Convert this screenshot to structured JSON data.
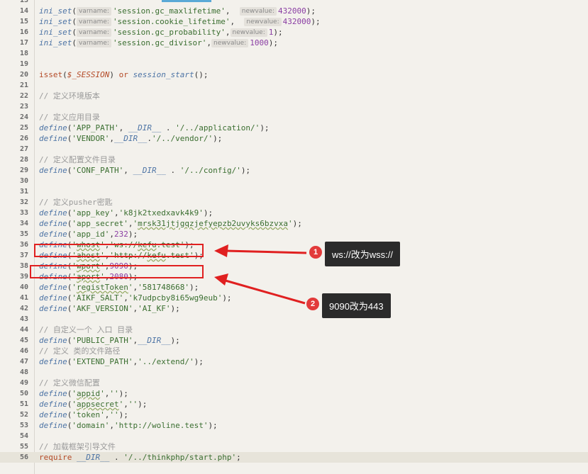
{
  "colors": {
    "annotation_red": "#e02020",
    "callout_bg": "#2b2b2b",
    "badge_red": "#e23a3a"
  },
  "lines": [
    {
      "n": "13",
      "html": ""
    },
    {
      "n": "14",
      "html": "<span class=\"fn\">ini_set</span>(<span class=\"hint\">varname:</span><span class=\"str\">'session.gc_maxlifetime'</span>,  <span class=\"hint\">newvalue:</span><span class=\"num\">432000</span>);"
    },
    {
      "n": "15",
      "html": "<span class=\"fn\">ini_set</span>(<span class=\"hint\">varname:</span><span class=\"str\">'session.cookie_lifetime'</span>,  <span class=\"hint\">newvalue:</span><span class=\"num\">432000</span>);"
    },
    {
      "n": "16",
      "html": "<span class=\"fn\">ini_set</span>(<span class=\"hint\">varname:</span><span class=\"str\">'session.gc_probability'</span>,<span class=\"hint\">newvalue:</span><span class=\"num\">1</span>);"
    },
    {
      "n": "17",
      "html": "<span class=\"fn\">ini_set</span>(<span class=\"hint\">varname:</span><span class=\"str\">'session.gc_divisor'</span>,<span class=\"hint\">newvalue:</span><span class=\"num\">1000</span>);"
    },
    {
      "n": "18",
      "html": ""
    },
    {
      "n": "19",
      "html": ""
    },
    {
      "n": "20",
      "html": "<span class=\"kw\">isset</span>(<span class=\"var\">$_SESSION</span>) <span class=\"kw\">or</span> <span class=\"fn\">session_start</span>();"
    },
    {
      "n": "21",
      "html": ""
    },
    {
      "n": "22",
      "html": "<span class=\"cm\">// 定义环境版本</span>"
    },
    {
      "n": "23",
      "html": ""
    },
    {
      "n": "24",
      "html": "<span class=\"cm\">// 定义应用目录</span>"
    },
    {
      "n": "25",
      "html": "<span class=\"fn\">define</span>(<span class=\"str\">'APP_PATH'</span>, <span class=\"const\">__DIR__</span> . <span class=\"str\">'/../application/'</span>);"
    },
    {
      "n": "26",
      "html": "<span class=\"fn\">define</span>(<span class=\"str\">'VENDOR'</span>,<span class=\"const\">__DIR__</span>.<span class=\"str\">'/../vendor/'</span>);"
    },
    {
      "n": "27",
      "html": ""
    },
    {
      "n": "28",
      "html": "<span class=\"cm\">// 定义配置文件目录</span>"
    },
    {
      "n": "29",
      "html": "<span class=\"fn\">define</span>(<span class=\"str\">'CONF_PATH'</span>, <span class=\"const\">__DIR__</span> . <span class=\"str\">'/../config/'</span>);"
    },
    {
      "n": "30",
      "html": ""
    },
    {
      "n": "31",
      "html": ""
    },
    {
      "n": "32",
      "html": "<span class=\"cm\">// 定义pusher密匙</span>"
    },
    {
      "n": "33",
      "html": "<span class=\"fn\">define</span>(<span class=\"str\">'app_key'</span>,<span class=\"str\">'k8jk2txedxavk4k9'</span>);"
    },
    {
      "n": "34",
      "html": "<span class=\"fn\">define</span>(<span class=\"str\">'app_secret'</span>,<span class=\"str\">'<span class=\"squig\">mrsk31jtjgqzjefyepzb2uvyks6bzvxa</span>'</span>);"
    },
    {
      "n": "35",
      "html": "<span class=\"fn\">define</span>(<span class=\"str\">'app_id'</span>,<span class=\"num\">232</span>);"
    },
    {
      "n": "36",
      "html": "<span class=\"fn\">define</span>(<span class=\"str\">'<span class=\"squig\">whost</span>'</span>,<span class=\"str\">'ws://<span class=\"squig\">kefu</span>.test'</span>);"
    },
    {
      "n": "37",
      "html": "<span class=\"fn\">define</span>(<span class=\"str\">'<span class=\"squig\">ahost</span>'</span>,<span class=\"str\">'http://<span class=\"squig\">kefu</span>.test'</span>);"
    },
    {
      "n": "38",
      "html": "<span class=\"fn\">define</span>(<span class=\"str\">'<span class=\"squig\">wport</span>'</span>,<span class=\"num\">9090</span>);"
    },
    {
      "n": "39",
      "html": "<span class=\"fn\">define</span>(<span class=\"str\">'<span class=\"squig\">aport</span>'</span>,<span class=\"num\">2080</span>);"
    },
    {
      "n": "40",
      "html": "<span class=\"fn\">define</span>(<span class=\"str\">'<span class=\"squig\">registToken</span>'</span>,<span class=\"str\">'581748668'</span>);"
    },
    {
      "n": "41",
      "html": "<span class=\"fn\">define</span>(<span class=\"str\">'AIKF_SALT'</span>,<span class=\"str\">'k7udpcby8i65wg9eub'</span>);"
    },
    {
      "n": "42",
      "html": "<span class=\"fn\">define</span>(<span class=\"str\">'AKF_VERSION'</span>,<span class=\"str\">'AI_KF'</span>);"
    },
    {
      "n": "43",
      "html": ""
    },
    {
      "n": "44",
      "html": "<span class=\"cm\">// 自定义一个 入口 目录</span>"
    },
    {
      "n": "45",
      "html": "<span class=\"fn\">define</span>(<span class=\"str\">'PUBLIC_PATH'</span>,<span class=\"const\">__DIR__</span>);"
    },
    {
      "n": "46",
      "html": "<span class=\"cm\">// 定义 类的文件路径</span>"
    },
    {
      "n": "47",
      "html": "<span class=\"fn\">define</span>(<span class=\"str\">'EXTEND_PATH'</span>,<span class=\"str\">'../extend/'</span>);"
    },
    {
      "n": "48",
      "html": ""
    },
    {
      "n": "49",
      "html": "<span class=\"cm\">// 定义微信配置</span>"
    },
    {
      "n": "50",
      "html": "<span class=\"fn\">define</span>(<span class=\"str\">'<span class=\"squig\">appid</span>'</span>,<span class=\"str\">''</span>);"
    },
    {
      "n": "51",
      "html": "<span class=\"fn\">define</span>(<span class=\"str\">'<span class=\"squig\">appsecret</span>'</span>,<span class=\"str\">''</span>);"
    },
    {
      "n": "52",
      "html": "<span class=\"fn\">define</span>(<span class=\"str\">'token'</span>,<span class=\"str\">''</span>);"
    },
    {
      "n": "53",
      "html": "<span class=\"fn\">define</span>(<span class=\"str\">'domain'</span>,<span class=\"str\">'http://woline.test'</span>);"
    },
    {
      "n": "54",
      "html": ""
    },
    {
      "n": "55",
      "html": "<span class=\"cm\">// 加载框架引导文件</span>"
    },
    {
      "n": "56",
      "html": "<span class=\"kw\">require</span> <span class=\"const\">__DIR__</span> . <span class=\"str\">'/../thinkphp/start.php'</span>;"
    }
  ],
  "annotations": [
    {
      "badge": "1",
      "text": "ws://改为wss://"
    },
    {
      "badge": "2",
      "text": "9090改为443"
    }
  ]
}
